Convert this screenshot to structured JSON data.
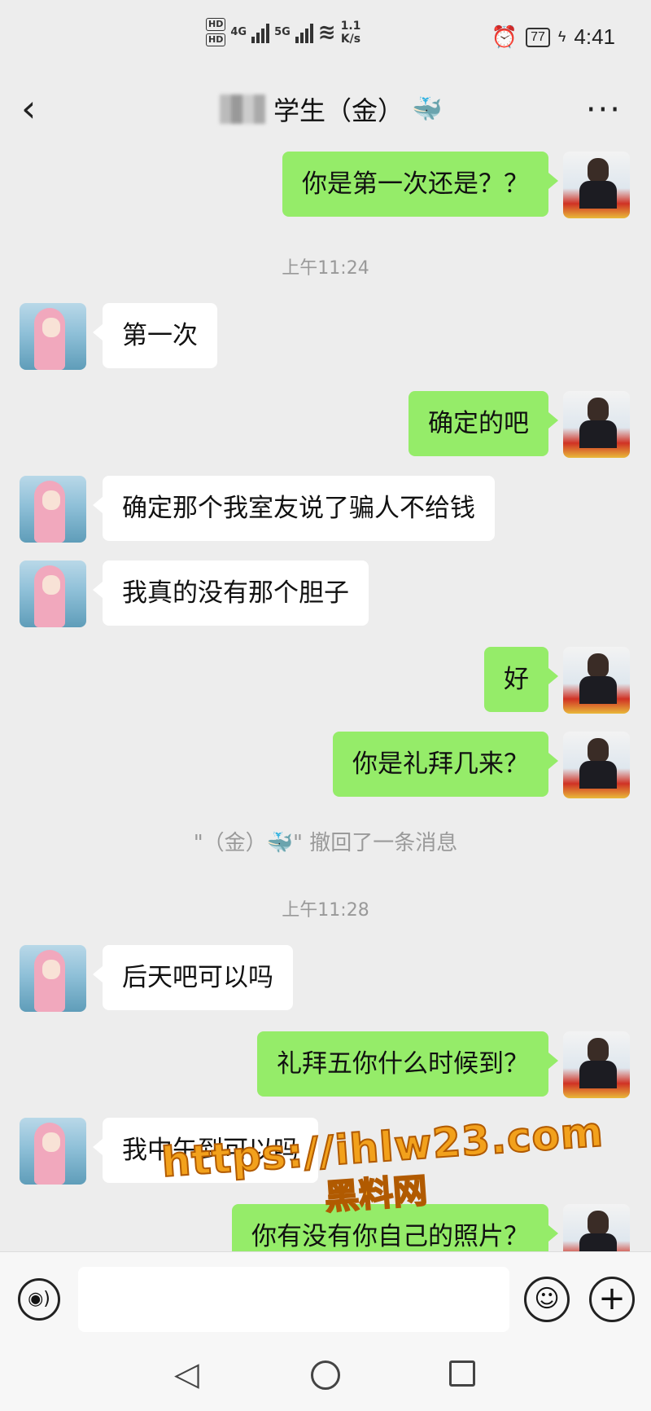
{
  "status_bar": {
    "hd1": "HD",
    "hd2": "HD",
    "net1": "4G",
    "net2": "5G",
    "speed_value": "1.1",
    "speed_unit": "K/s",
    "battery": "77",
    "time": "4:41"
  },
  "header": {
    "title": "学生（金）",
    "title_emoji": "🐳",
    "back_icon": "chevron-left-icon",
    "more_icon": "more-dots-icon"
  },
  "messages": [
    {
      "side": "self",
      "text": "你是第一次还是？？"
    },
    {
      "type": "timestamp",
      "text": "上午11:24"
    },
    {
      "side": "other",
      "text": "第一次"
    },
    {
      "side": "self",
      "text": "确定的吧"
    },
    {
      "side": "other",
      "text": "确定那个我室友说了骗人不给钱"
    },
    {
      "side": "other",
      "text": "我真的没有那个胆子"
    },
    {
      "side": "self",
      "text": "好"
    },
    {
      "side": "self",
      "text": "你是礼拜几来？"
    },
    {
      "type": "system",
      "text": "\"（金）🐳\" 撤回了一条消息"
    },
    {
      "type": "timestamp",
      "text": "上午11:28"
    },
    {
      "side": "other",
      "text": "后天吧可以吗"
    },
    {
      "side": "self",
      "text": "礼拜五你什么时候到？"
    },
    {
      "side": "other",
      "text": "我中午到可以吗"
    },
    {
      "side": "self",
      "text": "你有没有你自己的照片？"
    }
  ],
  "watermark": {
    "line1": "https://ihlw23.com",
    "line2": "黑料网"
  },
  "input_bar": {
    "voice_icon": "voice-icon",
    "emoji_icon": "emoji-icon",
    "plus_icon": "plus-icon",
    "placeholder": ""
  },
  "nav_bar": {
    "back_icon": "nav-back-icon",
    "home_icon": "nav-home-icon",
    "recent_icon": "nav-recent-icon"
  },
  "colors": {
    "self_bubble": "#95ec69",
    "other_bubble": "#ffffff",
    "background": "#ededed",
    "watermark": "#f2a11c"
  }
}
